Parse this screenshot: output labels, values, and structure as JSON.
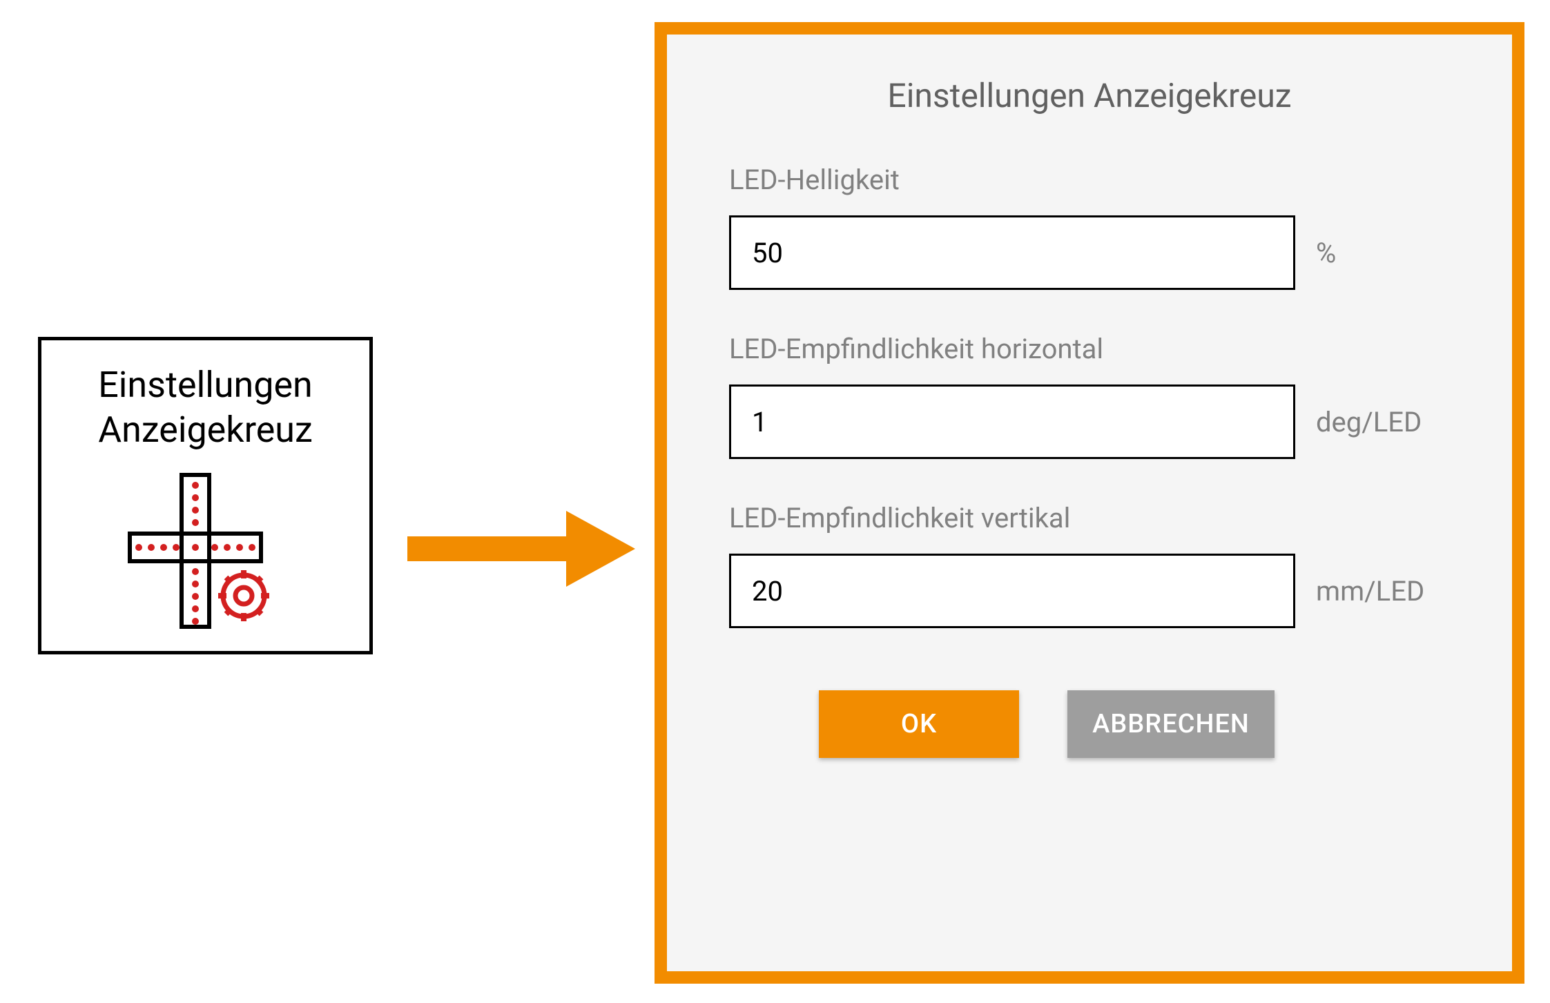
{
  "icon_card": {
    "title_line1": "Einstellungen",
    "title_line2": "Anzeigekreuz"
  },
  "dialog": {
    "title": "Einstellungen Anzeigekreuz",
    "fields": {
      "brightness": {
        "label": "LED-Helligkeit",
        "value": "50",
        "unit": "%"
      },
      "sensitivity_h": {
        "label": "LED-Empfindlichkeit horizontal",
        "value": "1",
        "unit": "deg/LED"
      },
      "sensitivity_v": {
        "label": "LED-Empfindlichkeit vertikal",
        "value": "20",
        "unit": "mm/LED"
      }
    },
    "buttons": {
      "ok": "OK",
      "cancel": "ABBRECHEN"
    }
  },
  "colors": {
    "accent": "#f28c00",
    "icon_red": "#d32020"
  }
}
